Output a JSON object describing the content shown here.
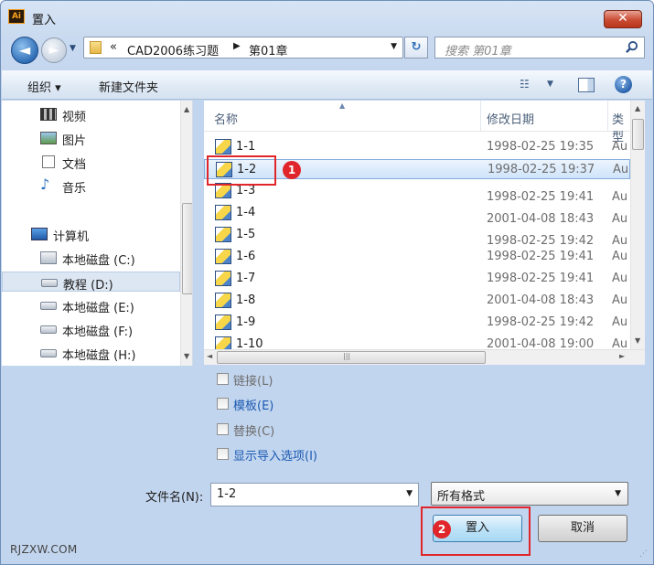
{
  "window": {
    "title": "置入",
    "app_icon_text": "Ai",
    "close_glyph": "✕"
  },
  "address": {
    "nav_back_glyph": "◄",
    "nav_forward_glyph": "►",
    "recent_glyph": "▼",
    "chevron": "«",
    "segments": [
      "CAD2006练习题",
      "第01章"
    ],
    "separator": "▶",
    "dropdown_glyph": "▼",
    "refresh_glyph": "↻"
  },
  "search": {
    "placeholder": "搜索 第01章"
  },
  "toolbar": {
    "organize_label": "组织 ▾",
    "new_folder_label": "新建文件夹",
    "views_glyph": "☷",
    "views_dd_glyph": "▼",
    "help_glyph": "?"
  },
  "nav": {
    "items": [
      {
        "label": "视频",
        "icon": "video-icon"
      },
      {
        "label": "图片",
        "icon": "pictures-icon"
      },
      {
        "label": "文档",
        "icon": "documents-icon"
      },
      {
        "label": "音乐",
        "icon": "music-icon"
      },
      {
        "label": "计算机",
        "icon": "computer-icon"
      },
      {
        "label": "本地磁盘 (C:)",
        "icon": "system-drive-icon"
      },
      {
        "label": "教程 (D:)",
        "icon": "drive-icon"
      },
      {
        "label": "本地磁盘 (E:)",
        "icon": "drive-icon"
      },
      {
        "label": "本地磁盘 (F:)",
        "icon": "drive-icon"
      },
      {
        "label": "本地磁盘 (H:)",
        "icon": "drive-icon"
      }
    ],
    "selected_index": 6,
    "music_glyph": "♪",
    "scroll_up": "▲",
    "scroll_down": "▼"
  },
  "filelist": {
    "columns": {
      "name": "名称",
      "date": "修改日期",
      "type": "类型"
    },
    "sort_glyph": "▲",
    "rows": [
      {
        "name": "1-1",
        "date": "1998-02-25 19:35",
        "type": "Au"
      },
      {
        "name": "1-2",
        "date": "1998-02-25 19:37",
        "type": "Au"
      },
      {
        "name": "1-3",
        "date": "1998-02-25 19:41",
        "type": "Au"
      },
      {
        "name": "1-4",
        "date": "2001-04-08 18:43",
        "type": "Au"
      },
      {
        "name": "1-5",
        "date": "1998-02-25 19:42",
        "type": "Au"
      },
      {
        "name": "1-6",
        "date": "1998-02-25 19:41",
        "type": "Au"
      },
      {
        "name": "1-7",
        "date": "1998-02-25 19:41",
        "type": "Au"
      },
      {
        "name": "1-8",
        "date": "2001-04-08 18:43",
        "type": "Au"
      },
      {
        "name": "1-9",
        "date": "1998-02-25 19:42",
        "type": "Au"
      },
      {
        "name": "1-10",
        "date": "2001-04-08 19:00",
        "type": "Au"
      }
    ],
    "selected_index": 1,
    "scroll_up": "▲",
    "scroll_down": "▼",
    "scroll_left": "◄",
    "scroll_right": "►",
    "hthumb_grip": "|||"
  },
  "options": [
    {
      "label": "链接(L)",
      "enabled": false
    },
    {
      "label": "模板(E)",
      "enabled": true
    },
    {
      "label": "替换(C)",
      "enabled": false
    },
    {
      "label": "显示导入选项(I)",
      "enabled": true
    }
  ],
  "filename": {
    "label": "文件名(N):",
    "value": "1-2",
    "dropdown_glyph": "▼"
  },
  "format": {
    "value": "所有格式",
    "dropdown_glyph": "▼"
  },
  "buttons": {
    "place": "置入",
    "cancel": "取消"
  },
  "annotations": {
    "badge1": "1",
    "badge2": "2",
    "color": "#e0262a"
  },
  "watermark": "RJZXW.COM",
  "grip_glyph": "⋰"
}
